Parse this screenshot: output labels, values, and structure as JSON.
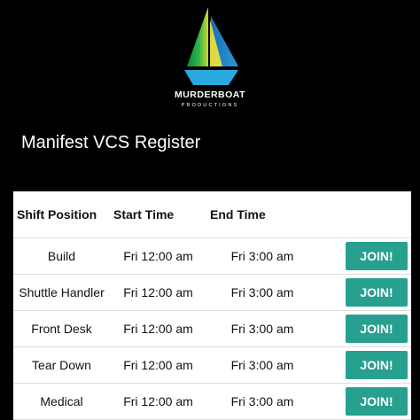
{
  "brand": {
    "name": "MURDERBOAT",
    "subtitle": "PRODUCTIONS"
  },
  "page": {
    "title": "Manifest VCS Register"
  },
  "table": {
    "headers": [
      "Shift Position",
      "Start Time",
      "End Time",
      ""
    ],
    "rows": [
      {
        "position": "Build",
        "start": "Fri 12:00 am",
        "end": "Fri 3:00 am",
        "action": "JOIN!"
      },
      {
        "position": "Shuttle Handler",
        "start": "Fri 12:00 am",
        "end": "Fri 3:00 am",
        "action": "JOIN!"
      },
      {
        "position": "Front Desk",
        "start": "Fri 12:00 am",
        "end": "Fri 3:00 am",
        "action": "JOIN!"
      },
      {
        "position": "Tear Down",
        "start": "Fri 12:00 am",
        "end": "Fri 3:00 am",
        "action": "JOIN!"
      },
      {
        "position": "Medical",
        "start": "Fri 12:00 am",
        "end": "Fri 3:00 am",
        "action": "JOIN!"
      }
    ]
  },
  "colors": {
    "background": "#000000",
    "accent": "#27a08f"
  }
}
